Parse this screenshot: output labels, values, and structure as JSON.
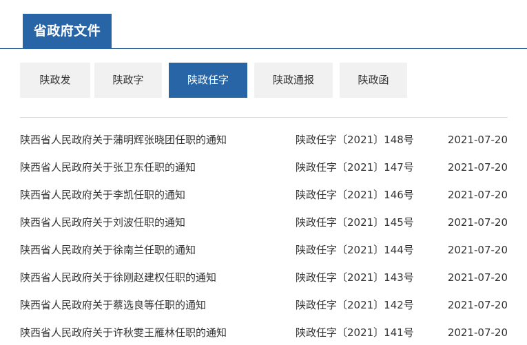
{
  "header": {
    "title": "省政府文件"
  },
  "tabs": [
    {
      "label": "陕政发",
      "active": false
    },
    {
      "label": "陕政字",
      "active": false
    },
    {
      "label": "陕政任字",
      "active": true
    },
    {
      "label": "陕政通报",
      "active": false
    },
    {
      "label": "陕政函",
      "active": false
    }
  ],
  "documents": [
    {
      "title": "陕西省人民政府关于蒲明辉张晓团任职的通知",
      "doc_no": "陕政任字〔2021〕148号",
      "date": "2021-07-20"
    },
    {
      "title": "陕西省人民政府关于张卫东任职的通知",
      "doc_no": "陕政任字〔2021〕147号",
      "date": "2021-07-20"
    },
    {
      "title": "陕西省人民政府关于李凯任职的通知",
      "doc_no": "陕政任字〔2021〕146号",
      "date": "2021-07-20"
    },
    {
      "title": "陕西省人民政府关于刘波任职的通知",
      "doc_no": "陕政任字〔2021〕145号",
      "date": "2021-07-20"
    },
    {
      "title": "陕西省人民政府关于徐南兰任职的通知",
      "doc_no": "陕政任字〔2021〕144号",
      "date": "2021-07-20"
    },
    {
      "title": "陕西省人民政府关于徐刚赵建权任职的通知",
      "doc_no": "陕政任字〔2021〕143号",
      "date": "2021-07-20"
    },
    {
      "title": "陕西省人民政府关于蔡选良等任职的通知",
      "doc_no": "陕政任字〔2021〕142号",
      "date": "2021-07-20"
    },
    {
      "title": "陕西省人民政府关于许秋雯王雁林任职的通知",
      "doc_no": "陕政任字〔2021〕141号",
      "date": "2021-07-20"
    }
  ],
  "colors": {
    "accent": "#2765a7",
    "tab_inactive_bg": "#f1f1f1",
    "text": "#333333"
  }
}
